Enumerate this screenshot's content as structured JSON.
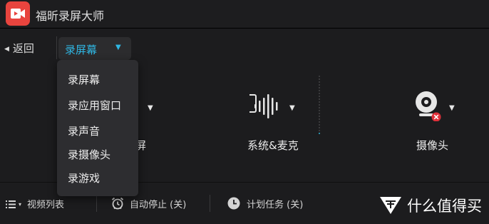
{
  "app": {
    "title": "福昕录屏大师"
  },
  "toolbar": {
    "back_label": "返回",
    "mode_selected": "录屏幕"
  },
  "dropdown": {
    "items": [
      "录屏幕",
      "录应用窗口",
      "录声音",
      "录摄像头",
      "录游戏"
    ]
  },
  "sources": {
    "screen_label_partial": "屏",
    "audio_label": "系统&麦克",
    "camera_label": "摄像头"
  },
  "bottombar": {
    "video_list": "视频列表",
    "auto_stop": "自动停止 (关)",
    "schedule": "计划任务 (关)"
  },
  "watermark": {
    "text": "什么值得买"
  },
  "colors": {
    "accent": "#2fb6e2",
    "logo": "#e8443e",
    "error": "#e0303a"
  }
}
